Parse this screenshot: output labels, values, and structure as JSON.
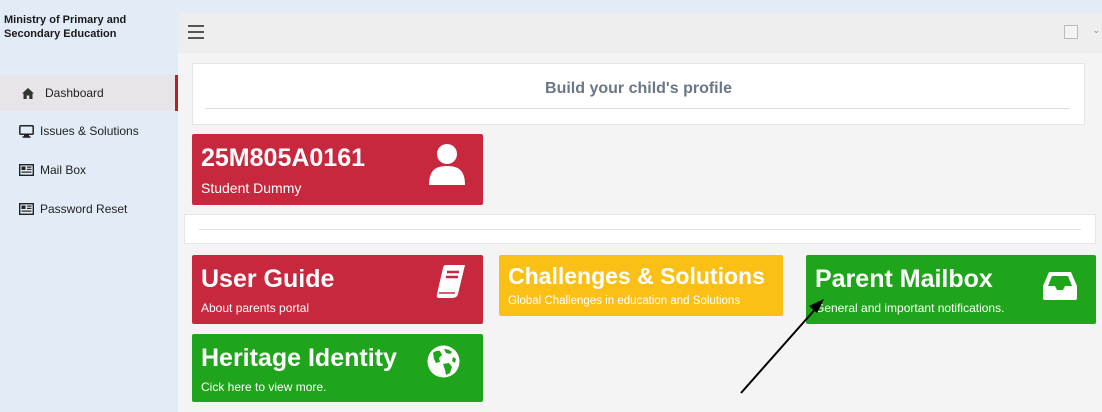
{
  "sidebar": {
    "brand": "Ministry of Primary and Secondary Education",
    "items": [
      {
        "label": "Dashboard",
        "icon": "home-icon",
        "active": true
      },
      {
        "label": "Issues & Solutions",
        "icon": "monitor-icon"
      },
      {
        "label": "Mail Box",
        "icon": "newspaper-icon"
      },
      {
        "label": "Password Reset",
        "icon": "newspaper-icon"
      }
    ]
  },
  "topbar": {
    "menu_icon": "hamburger-icon",
    "user_image": "broken-image-icon",
    "caret": "chevron-down-icon"
  },
  "profile": {
    "title": "Build your child's profile"
  },
  "student": {
    "id": "25M805A0161",
    "name": "Student Dummy",
    "icon": "user-icon"
  },
  "tiles": {
    "user_guide": {
      "title": "User Guide",
      "subtitle": "About parents portal",
      "icon": "book-icon"
    },
    "challenges": {
      "title": "Challenges & Solutions",
      "subtitle": "Global Challenges in education and Solutions"
    },
    "mailbox": {
      "title": "Parent Mailbox",
      "subtitle": "General and important notifications.",
      "icon": "inbox-icon"
    },
    "heritage": {
      "title": "Heritage Identity",
      "subtitle": "Cick here to view more.",
      "icon": "globe-icon"
    }
  },
  "colors": {
    "red": "#c8283e",
    "yellow": "#fbc016",
    "green": "#1fa51b",
    "sidebar_bg": "#e1ecf6",
    "active_border": "#b02424"
  }
}
